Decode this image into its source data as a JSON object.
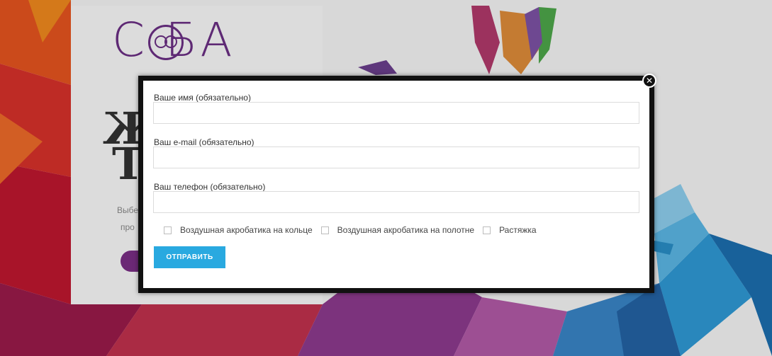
{
  "background": {
    "logo_text": "С  БА",
    "hero_letters": [
      "Ж",
      "Т"
    ],
    "hero_text_fragments": [
      "Выбе",
      "про"
    ]
  },
  "modal": {
    "close_symbol": "✕",
    "fields": [
      {
        "label": "Ваше имя (обязательно)",
        "value": "",
        "placeholder": ""
      },
      {
        "label": "Ваш e-mail (обязательно)",
        "value": "",
        "placeholder": ""
      },
      {
        "label": "Ваш телефон (обязательно)",
        "value": "",
        "placeholder": ""
      }
    ],
    "checkboxes": [
      {
        "label": "Воздушная акробатика на кольце",
        "checked": false
      },
      {
        "label": "Воздушная акробатика на полотне",
        "checked": false
      },
      {
        "label": "Растяжка",
        "checked": false
      }
    ],
    "submit_label": "ОТПРАВИТЬ"
  },
  "colors": {
    "accent": "#29a9e0",
    "brand": "#6b2f84",
    "modal_border": "#111111"
  }
}
